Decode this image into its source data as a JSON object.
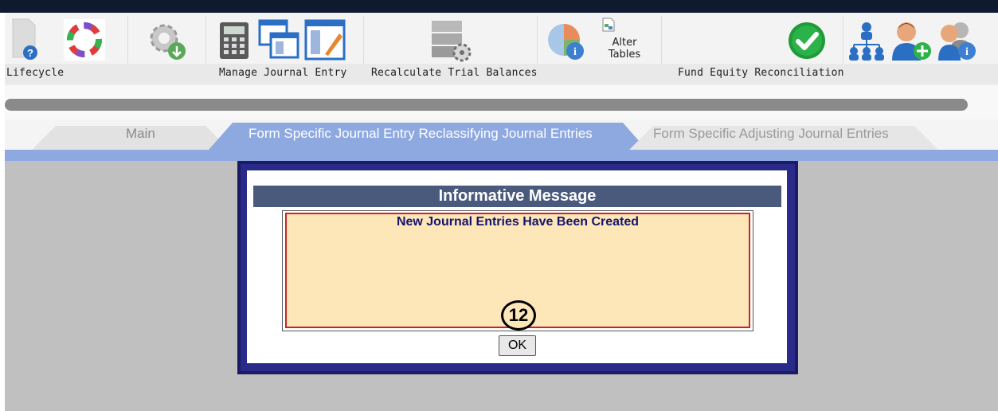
{
  "toolbar": {
    "lifecycle_label": "Lifecycle",
    "manage_journal_entry_label": "Manage Journal Entry",
    "recalculate_trial_balances_label": "Recalculate Trial Balances",
    "alter_tables_label": "Alter Tables",
    "fund_equity_reconciliation_label": "Fund Equity Reconciliation"
  },
  "tabs": [
    {
      "label": "Main",
      "active": false
    },
    {
      "label": "Form Specific Journal Entry Reclassifying Journal Entries",
      "active": true
    },
    {
      "label": "Form Specific Adjusting Journal Entries",
      "active": false
    }
  ],
  "dialog": {
    "title": "Informative Message",
    "message": "New Journal Entries Have Been Created",
    "step_marker": "12",
    "ok_label": "OK"
  },
  "colors": {
    "dialog_border": "#2a2a8a",
    "dialog_title_bg": "#4a5a7c",
    "message_bg": "#fde6b8",
    "message_border": "#cc2222",
    "active_tab": "#8ea8e0"
  }
}
